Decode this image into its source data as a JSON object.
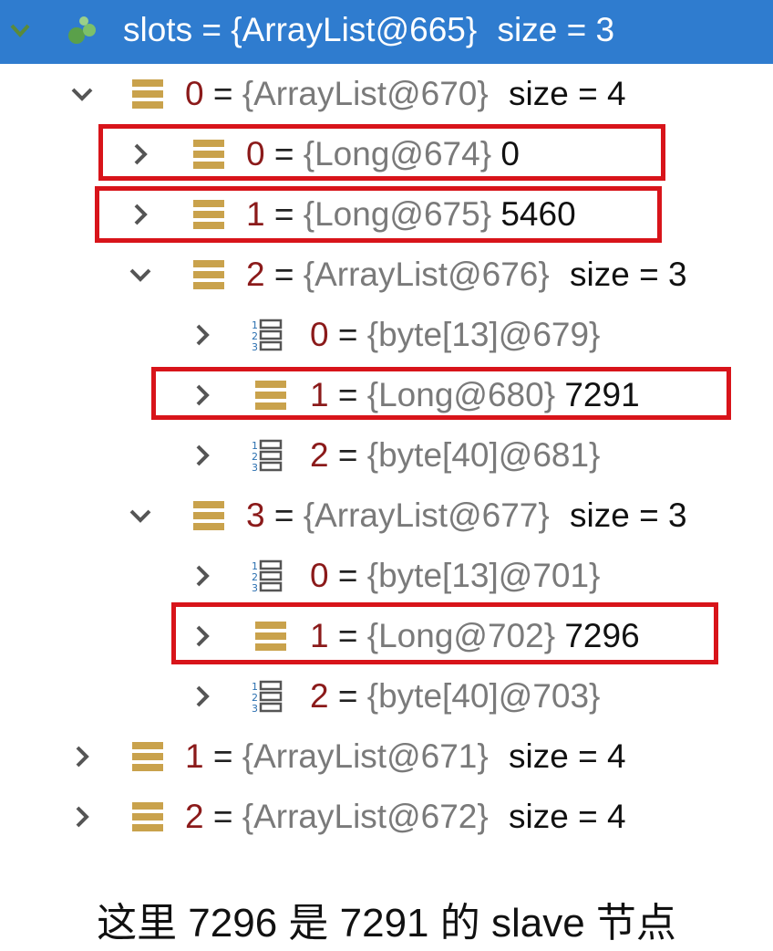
{
  "tree": {
    "root": {
      "name": "slots",
      "type": "{ArrayList@665}",
      "size": "size = 3"
    },
    "rows": [
      {
        "name": "0",
        "type": "{ArrayList@670}",
        "size": "size = 4"
      },
      {
        "name": "0",
        "type": "{Long@674}",
        "value": "0"
      },
      {
        "name": "1",
        "type": "{Long@675}",
        "value": "5460"
      },
      {
        "name": "2",
        "type": "{ArrayList@676}",
        "size": "size = 3"
      },
      {
        "name": "0",
        "type": "{byte[13]@679}"
      },
      {
        "name": "1",
        "type": "{Long@680}",
        "value": "7291"
      },
      {
        "name": "2",
        "type": "{byte[40]@681}"
      },
      {
        "name": "3",
        "type": "{ArrayList@677}",
        "size": "size = 3"
      },
      {
        "name": "0",
        "type": "{byte[13]@701}"
      },
      {
        "name": "1",
        "type": "{Long@702}",
        "value": "7296"
      },
      {
        "name": "2",
        "type": "{byte[40]@703}"
      },
      {
        "name": "1",
        "type": "{ArrayList@671}",
        "size": "size = 4"
      },
      {
        "name": "2",
        "type": "{ArrayList@672}",
        "size": "size = 4"
      }
    ]
  },
  "eq_sign": "=",
  "caption": "这里 7296 是 7291 的 slave 节点",
  "colors": {
    "selection": "#2f7ccf",
    "highlight_box": "#d8141a",
    "field_name": "#8b1a1a"
  },
  "icons": {
    "list": "list-field-icon",
    "bytes": "byte-array-icon",
    "object": "object-icon"
  }
}
